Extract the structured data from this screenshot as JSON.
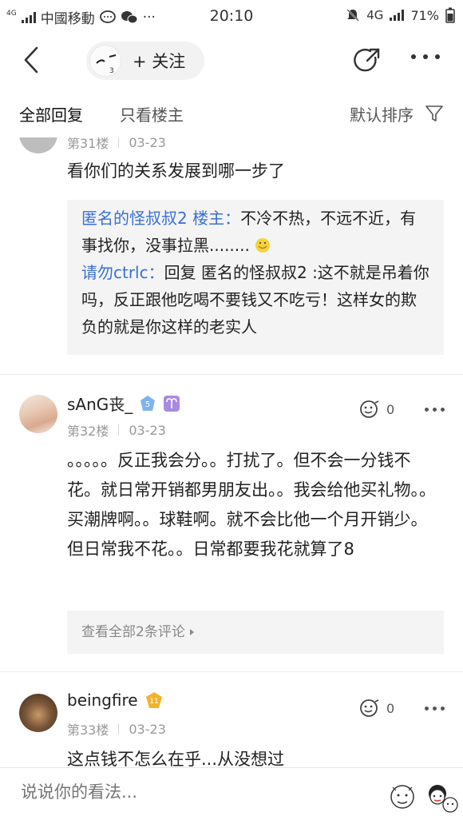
{
  "status_bar": {
    "network_small": "4G",
    "carrier": "中國移動",
    "time": "20:10",
    "network": "4G",
    "battery": "71%"
  },
  "topnav": {
    "follow_label": "+ 关注"
  },
  "tabs": {
    "all_replies": "全部回复",
    "op_only": "只看楼主",
    "sort_label": "默认排序"
  },
  "posts": [
    {
      "floor": "第31楼",
      "date": "03-23",
      "text": "看你们的关系发展到哪一步了",
      "replies": [
        {
          "name": "匿名的怪叔叔2 楼主：",
          "text": "不冷不热，不远不近，有事找你，没事拉黑........"
        },
        {
          "name": "请勿ctrlc：",
          "text": "回复 匿名的怪叔叔2 :这不就是吊着你吗，反正跟他吃喝不要钱又不吃亏！这样女的欺负的就是你这样的老实人"
        }
      ]
    },
    {
      "username": "sAnG丧_",
      "level": "5",
      "floor": "第32楼",
      "date": "03-23",
      "likes": "0",
      "text": "。。。。。反正我会分。。打扰了。但不会一分钱不花。就日常开销都男朋友出。。我会给他买礼物。。买潮牌啊。。球鞋啊。就不会比他一个月开销少。但日常我不花。。日常都要我花就算了8",
      "view_all": "查看全部2条评论"
    },
    {
      "username": "beingfire",
      "level": "11",
      "floor": "第33楼",
      "date": "03-23",
      "likes": "0",
      "text": "这点钱不怎么在乎...从没想过"
    }
  ],
  "bottom_bar": {
    "placeholder": "说说你的看法..."
  },
  "colors": {
    "accent_blue": "#3a6fd8",
    "level_badge_blue": "#7fb3f0",
    "level_badge_gold": "#f3b42a",
    "zodiac_purple": "#a88be0"
  },
  "icons": [
    "back-icon",
    "share-icon",
    "more-icon",
    "filter-icon",
    "like-icon",
    "chevron-right-icon",
    "aries-icon",
    "smile-emoji-icon"
  ]
}
